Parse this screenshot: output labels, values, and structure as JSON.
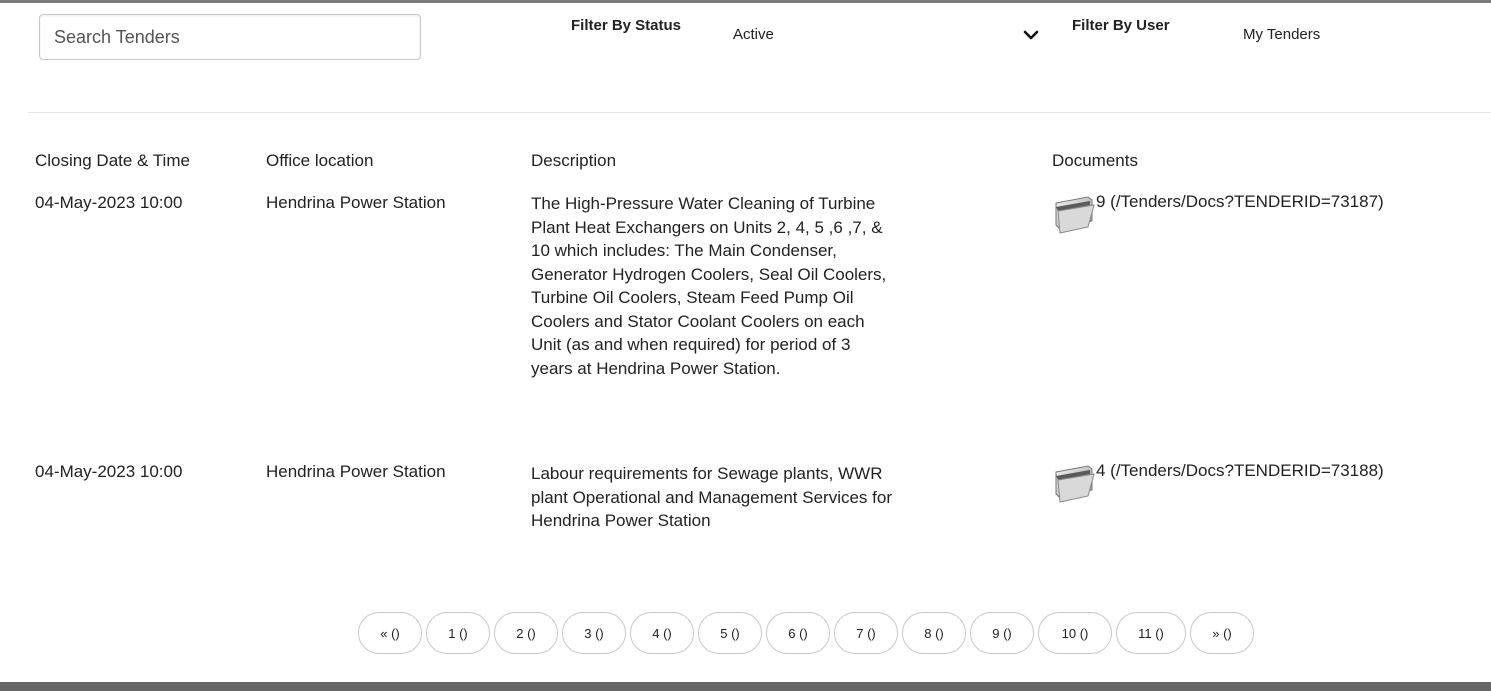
{
  "search": {
    "placeholder": "Search Tenders",
    "value": ""
  },
  "filters": {
    "status": {
      "label": "Filter By Status",
      "value": "Active"
    },
    "user": {
      "label": "Filter By User",
      "value": "My Tenders"
    }
  },
  "table": {
    "headers": [
      "Closing Date & Time",
      "Office location",
      "Description",
      "Documents"
    ],
    "rows": [
      {
        "closing": "04-May-2023 10:00",
        "office": "Hendrina Power Station",
        "description_lines": [
          "The High-Pressure Water Cleaning of Turbine",
          "Plant Heat Exchangers on Units 2, 4, 5 ,6 ,7, &",
          "10 which includes: The Main Condenser,",
          "Generator Hydrogen Coolers, Seal Oil Coolers,",
          "Turbine Oil Coolers, Steam Feed Pump Oil",
          "Coolers and Stator Coolant Coolers on each",
          "Unit (as and when required) for period of 3",
          "years at Hendrina Power Station."
        ],
        "documents": "9 (/Tenders/Docs?TENDERID=73187)"
      },
      {
        "closing": "04-May-2023 10:00",
        "office": "Hendrina Power Station",
        "description_lines": [
          "Labour requirements for Sewage plants, WWR",
          "plant Operational and Management Services for",
          "Hendrina Power Station"
        ],
        "documents": "4 (/Tenders/Docs?TENDERID=73188)"
      }
    ]
  },
  "pagination": [
    "« ()",
    "1 ()",
    "2 ()",
    "3 ()",
    "4 ()",
    "5 ()",
    "6 ()",
    "7 ()",
    "8 ()",
    "9 ()",
    "10 ()",
    "11 ()",
    "» ()"
  ],
  "icons": {
    "status_dropdown": "chevron-down-icon",
    "documents": "folder-icon"
  }
}
